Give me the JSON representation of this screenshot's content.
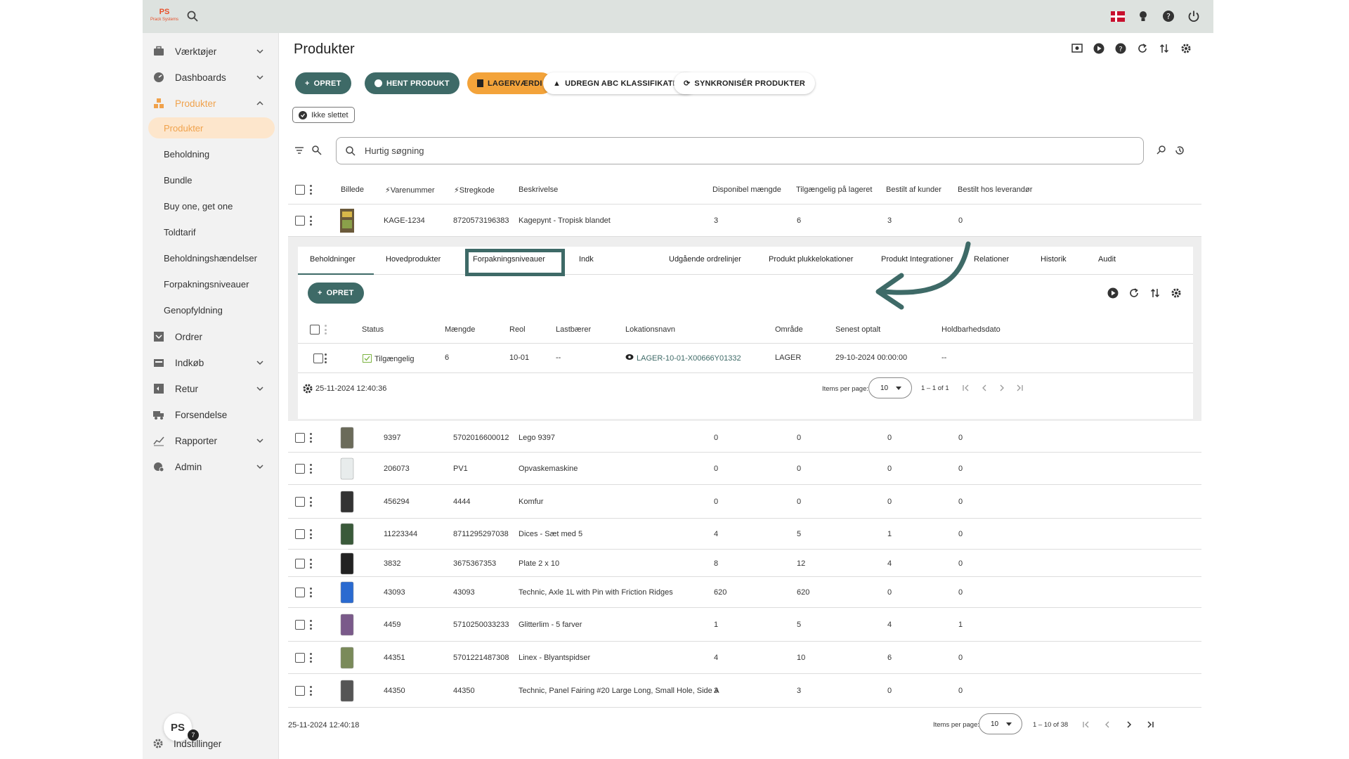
{
  "colors": {
    "accent": "#3e6a67",
    "orange": "#f3a33a",
    "active_nav": "#f0a24c",
    "topbar": "#dde2df"
  },
  "topbar": {
    "logo_text": "PS",
    "logo_sub": "Prack Systems"
  },
  "sidebar": {
    "items": [
      {
        "label": "Værktøjer",
        "icon": "toolbox-icon",
        "chevron": "down"
      },
      {
        "label": "Dashboards",
        "icon": "gauge-icon",
        "chevron": "down"
      },
      {
        "label": "Produkter",
        "icon": "boxes-icon",
        "chevron": "up",
        "active": true
      },
      {
        "label": "Ordrer",
        "icon": "inbox-icon"
      },
      {
        "label": "Indkøb",
        "icon": "basket-icon",
        "chevron": "down"
      },
      {
        "label": "Retur",
        "icon": "return-icon",
        "chevron": "down"
      },
      {
        "label": "Forsendelse",
        "icon": "truck-icon"
      },
      {
        "label": "Rapporter",
        "icon": "chart-icon",
        "chevron": "down"
      },
      {
        "label": "Admin",
        "icon": "admin-icon",
        "chevron": "down"
      }
    ],
    "sub_items": [
      "Produkter",
      "Beholdning",
      "Bundle",
      "Buy one, get one",
      "Toldtarif",
      "Beholdningshændelser",
      "Forpakningsniveauer",
      "Genopfyldning"
    ],
    "avatar_text": "PS",
    "avatar_badge": "7",
    "settings_label": "Indstillinger"
  },
  "page": {
    "title": "Produkter"
  },
  "buttons": {
    "create": "OPRET",
    "fetch": "HENT PRODUKT",
    "stock_value": "LAGERVÆRDI",
    "abc": "UDREGN ABC KLASSIFIKATION",
    "sync": "SYNKRONISÉR PRODUKTER"
  },
  "filter_chip": "Ikke slettet",
  "search": {
    "placeholder": "Hurtig søgning"
  },
  "table": {
    "headers": [
      "Billede",
      "Varenummer",
      "Stregkode",
      "Beskrivelse",
      "Disponibel mængde",
      "Tilgængelig på lageret",
      "Bestilt af kunder",
      "Bestilt hos leverandør"
    ],
    "first_row": {
      "varenr": "KAGE-1234",
      "stregkode": "8720573196383",
      "beskrivelse": "Kagepynt - Tropisk blandet",
      "disp": "3",
      "tilg": "6",
      "kunder": "3",
      "lev": "0"
    },
    "rows": [
      {
        "varenr": "9397",
        "stregkode": "5702016600012",
        "beskrivelse": "Lego 9397",
        "disp": "0",
        "tilg": "0",
        "kunder": "0",
        "lev": "0"
      },
      {
        "varenr": "206073",
        "stregkode": "PV1",
        "beskrivelse": "Opvaskemaskine",
        "disp": "0",
        "tilg": "0",
        "kunder": "0",
        "lev": "0"
      },
      {
        "varenr": "456294",
        "stregkode": "4444",
        "beskrivelse": "Komfur",
        "disp": "0",
        "tilg": "0",
        "kunder": "0",
        "lev": "0"
      },
      {
        "varenr": "11223344",
        "stregkode": "8711295297038",
        "beskrivelse": "Dices - Sæt med 5",
        "disp": "4",
        "tilg": "5",
        "kunder": "1",
        "lev": "0"
      },
      {
        "varenr": "3832",
        "stregkode": "3675367353",
        "beskrivelse": "Plate 2 x 10",
        "disp": "8",
        "tilg": "12",
        "kunder": "4",
        "lev": "0"
      },
      {
        "varenr": "43093",
        "stregkode": "43093",
        "beskrivelse": "Technic, Axle 1L with Pin with Friction Ridges",
        "disp": "620",
        "tilg": "620",
        "kunder": "0",
        "lev": "0"
      },
      {
        "varenr": "4459",
        "stregkode": "5710250033233",
        "beskrivelse": "Glitterlim - 5 farver",
        "disp": "1",
        "tilg": "5",
        "kunder": "4",
        "lev": "1"
      },
      {
        "varenr": "44351",
        "stregkode": "5701221487308",
        "beskrivelse": "Linex - Blyantspidser",
        "disp": "4",
        "tilg": "10",
        "kunder": "6",
        "lev": "0"
      },
      {
        "varenr": "44350",
        "stregkode": "44350",
        "beskrivelse": "Technic, Panel Fairing #20 Large Long, Small Hole, Side A",
        "disp": "3",
        "tilg": "3",
        "kunder": "0",
        "lev": "0"
      }
    ],
    "footer": {
      "timestamp": "25-11-2024 12:40:18",
      "items_per_page_label": "Items per page:",
      "items_per_page": "10",
      "range": "1 – 10 of 38"
    }
  },
  "detail": {
    "tabs": [
      "Beholdninger",
      "Hovedprodukter",
      "Forpakningsniveauer",
      "Indk",
      "Udgående ordrelinjer",
      "Produkt plukkelokationer",
      "Produkt Integrationer",
      "Relationer",
      "Historik",
      "Audit"
    ],
    "create_label": "OPRET",
    "headers": [
      "Status",
      "Mængde",
      "Reol",
      "Lastbærer",
      "Lokationsnavn",
      "Område",
      "Senest optalt",
      "Holdbarhedsdato"
    ],
    "row": {
      "status": "Tilgængelig",
      "maengde": "6",
      "reol": "10-01",
      "lastbaerer": "--",
      "lokation": "LAGER-10-01-X00666Y01332",
      "omraade": "LAGER",
      "optalt": "29-10-2024 00:00:00",
      "holdbarhed": "--"
    },
    "footer": {
      "timestamp": "25-11-2024 12:40:36",
      "items_per_page_label": "Items per page:",
      "items_per_page": "10",
      "range": "1 – 1 of 1"
    }
  }
}
